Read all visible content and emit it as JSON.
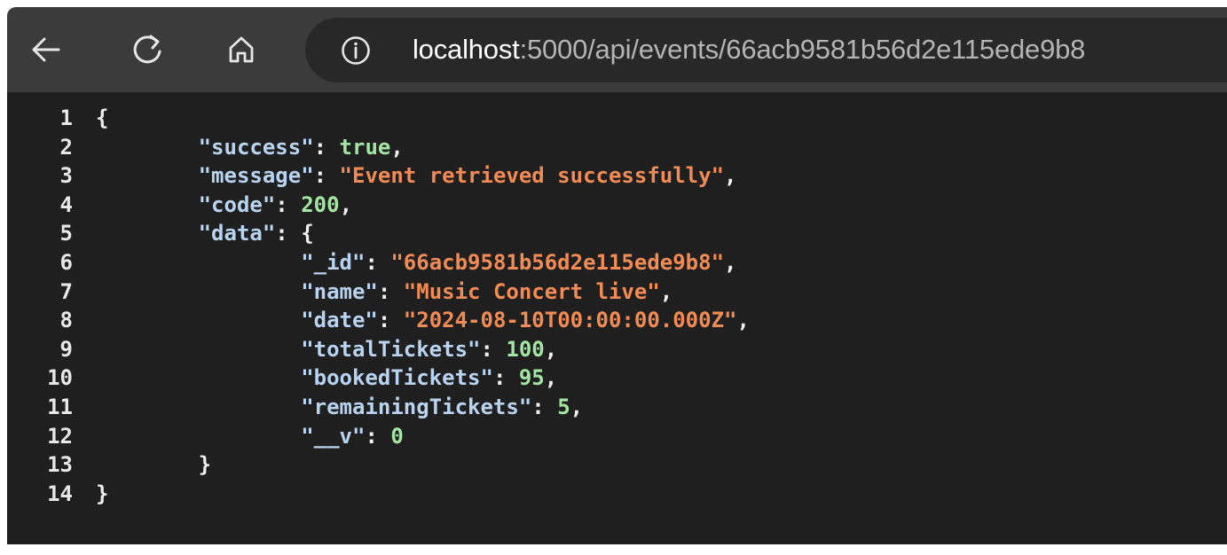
{
  "browser": {
    "url_host": "localhost",
    "url_path": ":5000/api/events/66acb9581b56d2e115ede9b8",
    "icons": {
      "back": "back-arrow-icon",
      "reload": "reload-icon",
      "home": "home-icon",
      "info": "info-icon"
    }
  },
  "json_viewer": {
    "line_numbers": [
      "1",
      "2",
      "3",
      "4",
      "5",
      "6",
      "7",
      "8",
      "9",
      "10",
      "11",
      "12",
      "13",
      "14"
    ],
    "open_brace": "{",
    "close_brace": "}",
    "success_key": "\"success\"",
    "success_value": "true",
    "message_key": "\"message\"",
    "message_value": "\"Event retrieved successfully\"",
    "code_key": "\"code\"",
    "code_value": "200",
    "data_key": "\"data\"",
    "id_key": "\"_id\"",
    "id_value": "\"66acb9581b56d2e115ede9b8\"",
    "name_key": "\"name\"",
    "name_value": "\"Music Concert live\"",
    "date_key": "\"date\"",
    "date_value": "\"2024-08-10T00:00:00.000Z\"",
    "total_key": "\"totalTickets\"",
    "total_value": "100",
    "booked_key": "\"bookedTickets\"",
    "booked_value": "95",
    "remaining_key": "\"remainingTickets\"",
    "remaining_value": "5",
    "v_key": "\"__v\"",
    "v_value": "0",
    "colon": ": ",
    "comma": ","
  }
}
